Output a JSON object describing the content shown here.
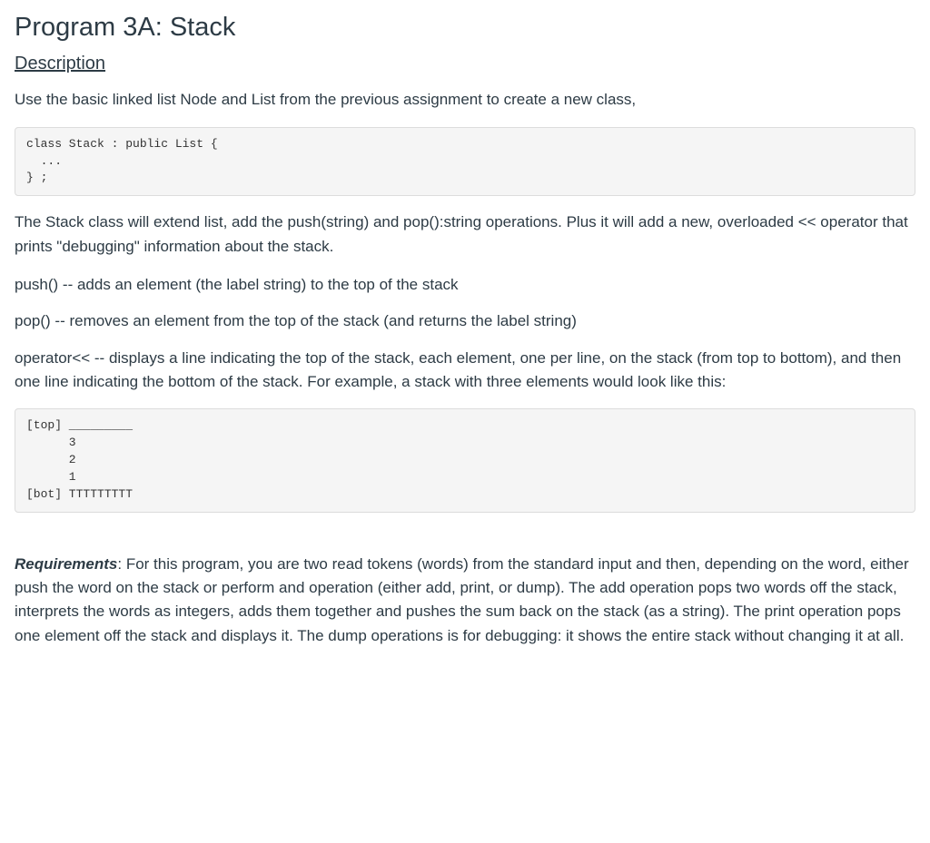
{
  "title": "Program 3A: Stack",
  "desc_heading": "Description",
  "intro": "Use the basic linked list Node and List from the previous assignment to create a new class,",
  "code1": "class Stack : public List {\n  ...\n} ;",
  "para_extend": "The Stack class will extend list, add the push(string) and pop():string operations.  Plus it will add a new, overloaded << operator that prints \"debugging\" information about the stack.",
  "para_push": "push() -- adds an element (the label string) to the top of the stack",
  "para_pop": "pop() -- removes an element from the top of the stack (and returns the label string)",
  "para_operator": "operator<< -- displays a line indicating the top of the stack, each element, one per line, on the stack (from top to bottom), and then one line indicating the bottom of the stack.  For example, a stack with three elements would look like this:",
  "code2": "[top] _________\n      3\n      2\n      1\n[bot] TTTTTTTTT",
  "requirements_label": "Requirements",
  "requirements_text": ": For this program, you are two read tokens (words) from the standard input and then, depending on the word, either push the word on the stack or perform and operation (either add, print, or dump).  The add operation pops two words off the stack, interprets the words as integers, adds them together and pushes the sum back on the stack (as a string).  The print operation pops one element off the stack and displays it.  The dump operations is for debugging:  it shows the entire stack without changing it at all."
}
